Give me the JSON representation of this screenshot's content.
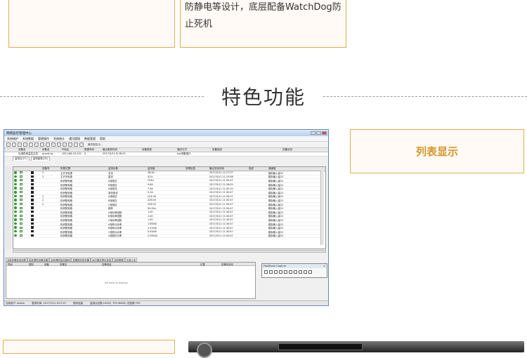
{
  "top_card": {
    "text": "防静电等设计，底层配备WatchDog防止死机"
  },
  "section": {
    "title": "特色功能"
  },
  "feature_card": {
    "label": "列表显示"
  },
  "app": {
    "window_title": "网络监控管理中心",
    "menu": [
      "系统维护",
      "系统数据",
      "管理操作",
      "系统统计",
      "通讯管理",
      "数据管理",
      "帮助"
    ],
    "toolbar_text": [
      "事件报告中..."
    ],
    "device_columns": [
      "设备名",
      "设备名",
      "IP地址",
      "数据号码",
      "最近更新时间",
      "设备类型",
      "通讯方式",
      "设备描述",
      "设备状态"
    ],
    "device_row": [
      "仪用机房监控主机",
      "guard-sa",
      "192.168.10.242",
      "0",
      "2017/3/11 8:28:22",
      "",
      "tcp采集端口",
      "",
      ""
    ],
    "sub_tabs": [
      "监测点(27)",
      "监测链表(28)"
    ],
    "grid_columns": [
      "",
      "",
      "",
      "",
      "",
      "设备号",
      "所属位置",
      "监测对象",
      "监测值",
      "告警信息",
      "最近变化时间",
      "描述",
      "通道值"
    ],
    "grid_rows": [
      [
        "2",
        "主开关电源",
        "总流",
        "36.4A",
        "2017/3/11 11:27:07",
        "模拟输入量22"
      ],
      [
        "2",
        "主开关电源",
        "直流",
        "41%",
        "2017/3/11 11:13:58",
        "模拟输入量22"
      ],
      [
        "",
        "机房配电箱",
        "A相电压",
        "224V",
        "2017/3/11 11:30:47",
        "模拟输入量22"
      ],
      [
        "",
        "机房配电箱",
        "B相电压",
        "9.6A",
        "2017/3/11 11:28:05",
        "模拟输入量22"
      ],
      [
        "",
        "机房配电箱",
        "A相电流",
        "7.9A",
        "2017/3/11 11:30:10",
        "模拟输入量22"
      ],
      [
        "",
        "机房配电箱",
        "零线电流",
        "0.2A",
        "2017/3/11 11:30:47",
        "模拟输入量22"
      ],
      [
        "2",
        "机房配电箱",
        "A相电压",
        "224.0V",
        "2017/3/11 11:30:07",
        "模拟输入量22"
      ],
      [
        "2",
        "机房配电箱",
        "B相电压",
        "226.0V",
        "2017/3/11 11:30:47",
        "模拟输入量22"
      ],
      [
        "2",
        "机房配电箱",
        "C相电压",
        "226.0V",
        "2017/3/11 11:30:47",
        "模拟输入量22"
      ],
      [
        "",
        "机房配电箱",
        "频率",
        "50.0Hz",
        "2017/3/11 11:30:47",
        "模拟输入量22"
      ],
      [
        "",
        "机房配电箱",
        "A相功率因数",
        "1.00",
        "2017/3/11 11:30:47",
        "模拟输入量22"
      ],
      [
        "",
        "机房配电箱",
        "B相功率因数",
        "1.00",
        "2017/3/11 11:30:47",
        "模拟输入量22"
      ],
      [
        "",
        "机房配电箱",
        "C相功率因数",
        "1.00",
        "2017/3/11 11:30:47",
        "模拟输入量22"
      ],
      [
        "",
        "机房配电箱",
        "A相有功功率",
        "1.65kW",
        "2017/3/11 11:30:47",
        "模拟输入量22"
      ],
      [
        "",
        "机房配电箱",
        "B相有功功率",
        "2.07kW",
        "2017/3/11 11:30:47",
        "模拟输入量22"
      ],
      [
        "",
        "机房配电箱",
        "C相有功功率",
        "0.92kW",
        "2017/3/11 11:30:47",
        "模拟输入量22"
      ],
      [
        "",
        "机房配电箱",
        "A相视在功率",
        "2.05kVA",
        "2017/3/11 11:30:47",
        "模拟输入量22"
      ]
    ],
    "bottom_tabs": [
      "当前告警信息列表",
      "未处理的设备告警",
      "未处理的监控模块",
      "查看报告的告警",
      "运行报告提示信息",
      "实时数据",
      "告警记录"
    ],
    "bottom_columns": [
      "时间",
      "类别",
      "设备",
      "告警名",
      "告警信息",
      "位置",
      "告警状态号"
    ],
    "bottom_empty": "No data to display",
    "capture_title": "FastStone Capture",
    "status": [
      "当前用户: admin",
      "登录时间: 2017/3/11 8:27:07",
      "服务连接",
      "监测点总数:19492, TCP:46462, 信息数:792"
    ]
  }
}
